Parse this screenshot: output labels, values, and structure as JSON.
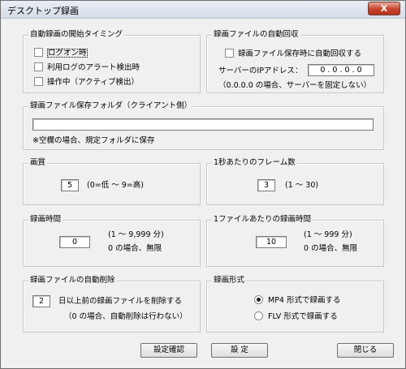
{
  "window": {
    "title": "デスクトップ録画",
    "close_icon": "close-icon",
    "close_glyph": "X"
  },
  "start_timing": {
    "legend": "自動録画の開始タイミング",
    "options": [
      "ログオン時",
      "利用ログのアラート検出時",
      "操作中（アクティブ検出）"
    ]
  },
  "auto_collect": {
    "legend": "録画ファイルの自動回収",
    "auto_collect_label": "録画ファイル保存時に自動回収する",
    "server_ip_label": "サーバーのIPアドレス：",
    "ip_octets": [
      "0",
      "0",
      "0",
      "0"
    ],
    "note": "（0.0.0.0 の場合、サーバーを固定しない）"
  },
  "save_folder": {
    "legend": "録画ファイル保存フォルダ（クライアント側）",
    "path_value": "",
    "note": "※空欄の場合、規定フォルダに保存"
  },
  "quality": {
    "legend": "画質",
    "value": "5",
    "hint": "(0=低 ～ 9=高)"
  },
  "fps": {
    "legend": "1秒あたりのフレーム数",
    "value": "3",
    "hint": "(1 ～ 30)"
  },
  "rec_time": {
    "legend": "録画時間",
    "value": "0",
    "range": "(1 ～ 9,999 分)",
    "note": "0 の場合、無限"
  },
  "file_time": {
    "legend": "1ファイルあたりの録画時間",
    "value": "10",
    "range": "(1 ～ 999 分)",
    "note": "0 の場合、無限"
  },
  "auto_delete": {
    "legend": "録画ファイルの自動削除",
    "value": "2",
    "suffix": "日以上前の録画ファイルを削除する",
    "note": "（0 の場合、自動削除は行わない）"
  },
  "format": {
    "legend": "録画形式",
    "options": [
      "MP4 形式で録画する",
      "FLV 形式で録画する"
    ],
    "selected": 0
  },
  "buttons": {
    "confirm": "設定確認",
    "apply": "設 定",
    "close": "閉じる"
  }
}
